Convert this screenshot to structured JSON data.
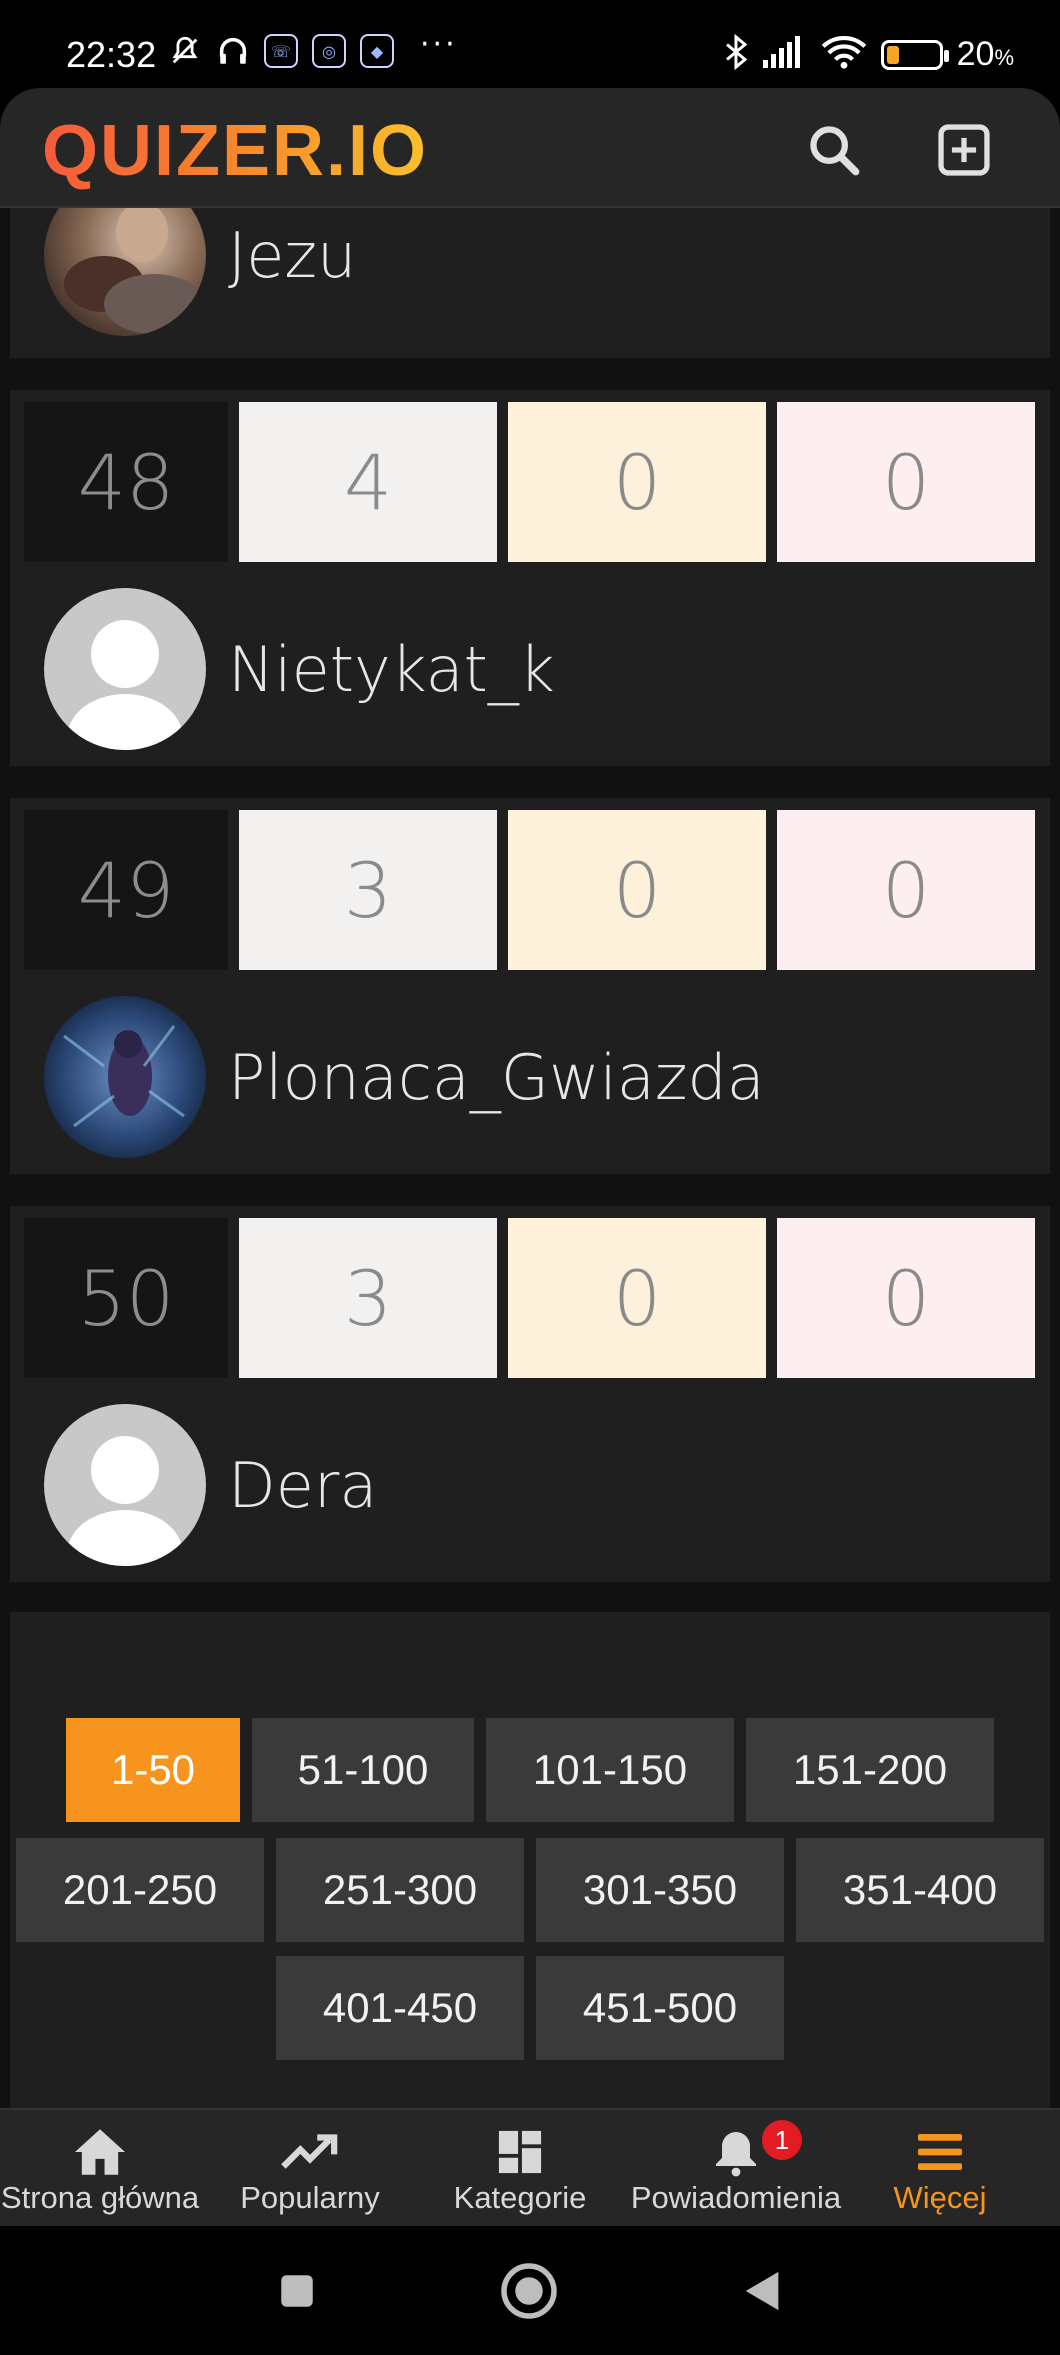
{
  "status_bar": {
    "time": "22:32",
    "battery_percent": "20",
    "battery_unit": "%",
    "icons": [
      "mute-icon",
      "headphones-icon",
      "call-icon",
      "app-icon",
      "app-icon",
      "bluetooth-icon",
      "signal-icon",
      "wifi-icon",
      "battery-icon"
    ]
  },
  "header": {
    "logo": "QUIZER.IO",
    "icons": [
      "search-icon",
      "add-icon"
    ]
  },
  "leaderboard": [
    {
      "rank": "",
      "username": "Jezu",
      "avatar": "photo"
    },
    {
      "rank": "48",
      "score": "4",
      "second": "0",
      "third": "0",
      "username": "Nietykat_k",
      "avatar": "default"
    },
    {
      "rank": "49",
      "score": "3",
      "second": "0",
      "third": "0",
      "username": "Plonaca_Gwiazda",
      "avatar": "photo"
    },
    {
      "rank": "50",
      "score": "3",
      "second": "0",
      "third": "0",
      "username": "Dera",
      "avatar": "default"
    }
  ],
  "pagination": {
    "pages": [
      "1-50",
      "51-100",
      "101-150",
      "151-200",
      "201-250",
      "251-300",
      "301-350",
      "351-400",
      "401-450",
      "451-500"
    ],
    "active": "1-50"
  },
  "bottom_nav": {
    "items": [
      {
        "label": "Strona główna",
        "icon": "home-icon"
      },
      {
        "label": "Popularny",
        "icon": "trending-icon"
      },
      {
        "label": "Kategorie",
        "icon": "dashboard-icon"
      },
      {
        "label": "Powiadomienia",
        "icon": "bell-icon"
      },
      {
        "label": "Więcej",
        "icon": "menu-icon"
      }
    ],
    "notification_count": "1",
    "active_color": "#f7941d"
  },
  "system_nav": [
    "recents-icon",
    "home-icon",
    "back-icon"
  ]
}
